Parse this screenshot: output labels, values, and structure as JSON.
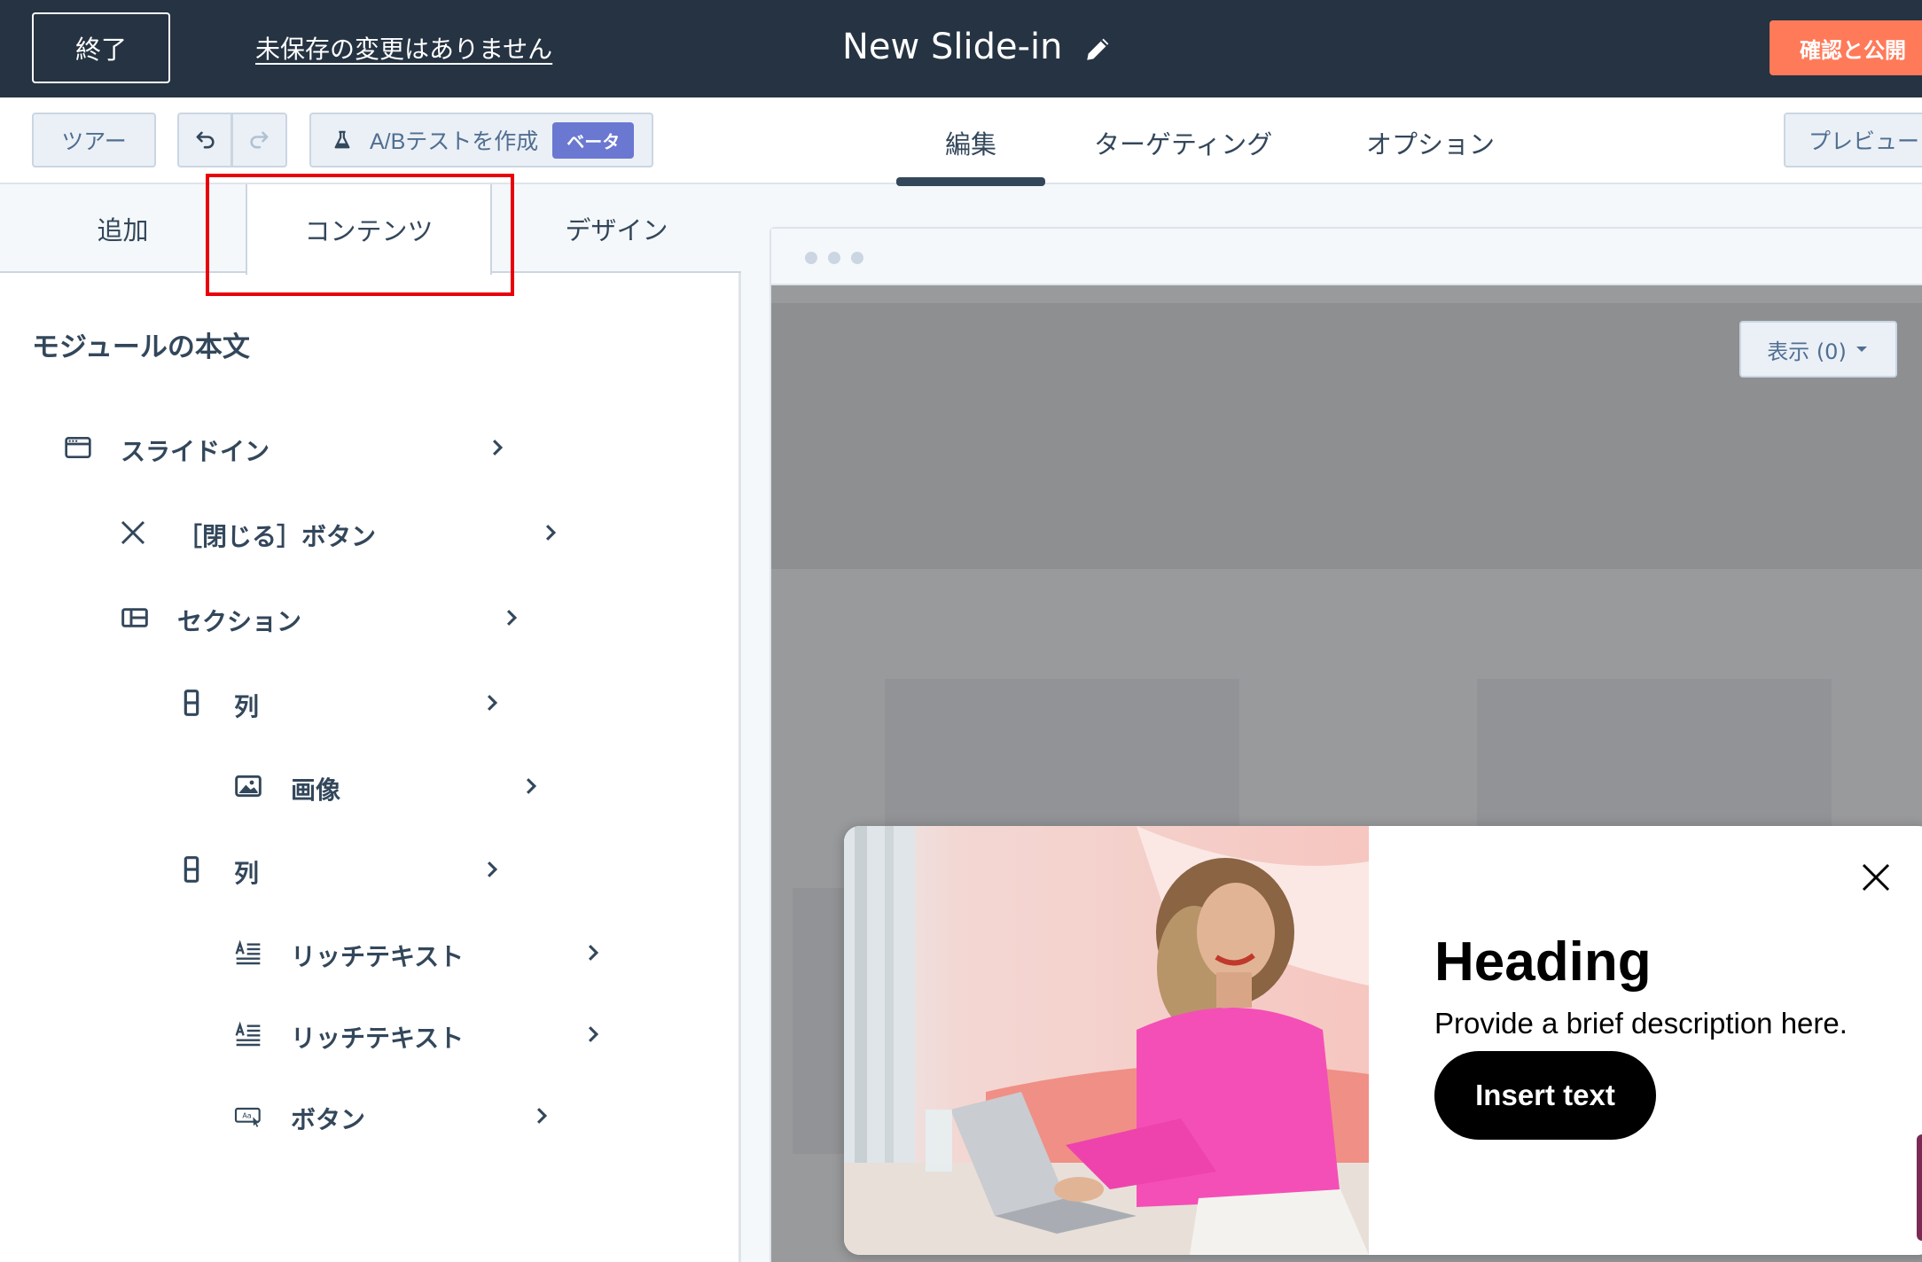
{
  "topbar": {
    "exit_label": "終了",
    "unsaved_text": "未保存の変更はありません",
    "title": "New Slide-in",
    "publish_label": "確認と公開"
  },
  "toolbar": {
    "tour_label": "ツアー",
    "ab_label": "A/Bテストを作成",
    "beta_badge": "ベータ",
    "tabs": [
      {
        "label": "編集",
        "active": true
      },
      {
        "label": "ターゲティング",
        "active": false
      },
      {
        "label": "オプション",
        "active": false
      }
    ],
    "preview_label": "プレビュー"
  },
  "sidebar": {
    "tabs": [
      {
        "label": "追加"
      },
      {
        "label": "コンテンツ",
        "active": true
      },
      {
        "label": "デザイン"
      }
    ],
    "heading": "モジュールの本文",
    "tree": [
      {
        "label": "スライドイン",
        "icon": "window-icon"
      },
      {
        "label": "［閉じる］ボタン",
        "icon": "close-icon"
      },
      {
        "label": "セクション",
        "icon": "section-icon"
      },
      {
        "label": "列",
        "icon": "column-icon"
      },
      {
        "label": "画像",
        "icon": "image-icon"
      },
      {
        "label": "列",
        "icon": "column-icon"
      },
      {
        "label": "リッチテキスト",
        "icon": "rich-text-icon"
      },
      {
        "label": "リッチテキスト",
        "icon": "rich-text-icon"
      },
      {
        "label": "ボタン",
        "icon": "button-icon"
      }
    ]
  },
  "canvas": {
    "view_label": "表示 (0)"
  },
  "slidein": {
    "heading": "Heading",
    "description": "Provide a brief description here.",
    "button_label": "Insert text"
  },
  "colors": {
    "topbar": "#253342",
    "publish": "#ff7a59",
    "beta": "#6a78d1",
    "highlight": "#e8000b",
    "text": "#33475b"
  }
}
